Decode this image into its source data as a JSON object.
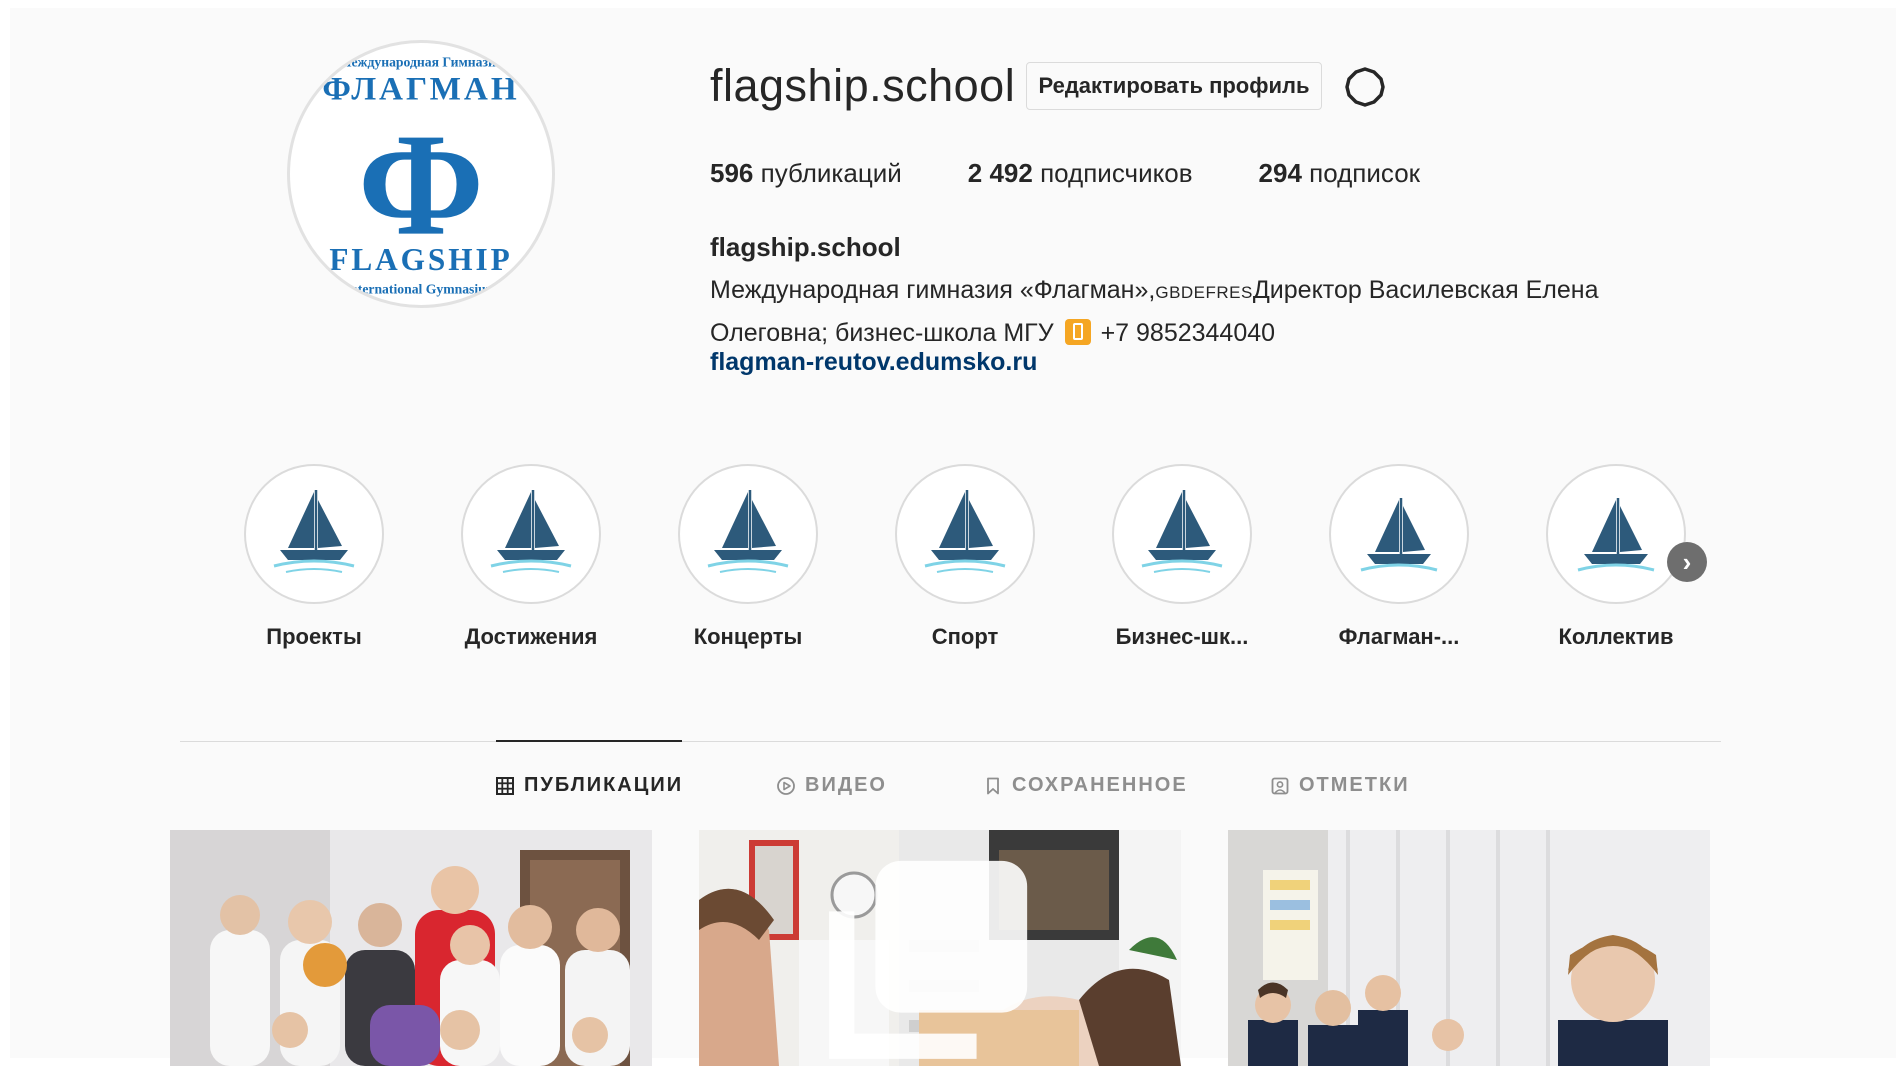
{
  "profile": {
    "username": "flagship.school",
    "edit_button": "Редактировать профиль",
    "avatar_logo": {
      "top_text": "Международная Гимназия",
      "main_text": "ФЛАГМАН",
      "letter": "Ф",
      "bottom_text": "FLAGSHIP",
      "footer_text": "International Gymnasium"
    }
  },
  "stats": [
    {
      "count": "596",
      "label": "публикаций"
    },
    {
      "count": "2 492",
      "label": "подписчиков"
    },
    {
      "count": "294",
      "label": "подписок"
    }
  ],
  "bio": {
    "name": "flagship.school",
    "line1_a": "Международная гимназия «Флагман»,",
    "line1_b": "GBDEFRES",
    "line1_c": "Директор Василевская Елена",
    "line2_a": "Олеговна; бизнес-школа МГУ",
    "line2_b": "+7 9852344040",
    "link": "flagman-reutov.edumsko.ru"
  },
  "highlights": [
    {
      "label": "Проекты"
    },
    {
      "label": "Достижения"
    },
    {
      "label": "Концерты"
    },
    {
      "label": "Спорт"
    },
    {
      "label": "Бизнес-шк..."
    },
    {
      "label": "Флагман-..."
    },
    {
      "label": "Коллектив"
    }
  ],
  "tabs": [
    {
      "label": "ПУБЛИКАЦИИ",
      "icon": "grid-icon"
    },
    {
      "label": "ВИДЕО",
      "icon": "play-icon"
    },
    {
      "label": "СОХРАНЕННОЕ",
      "icon": "bookmark-icon"
    },
    {
      "label": "ОТМЕТКИ",
      "icon": "tag-person-icon"
    }
  ],
  "colors": {
    "link": "#00376b",
    "sail": "#2d5a7b",
    "water": "#7fd3e6",
    "logo_blue": "#1a6fb5"
  }
}
